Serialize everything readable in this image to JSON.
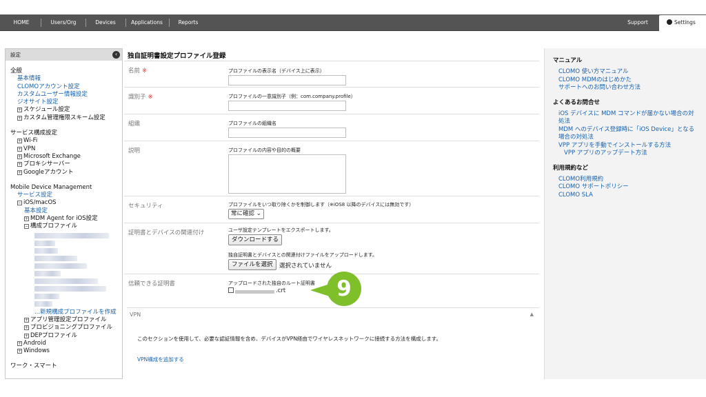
{
  "topnav": {
    "items": [
      "HOME",
      "Users/Org",
      "Devices",
      "Applications",
      "Reports"
    ],
    "support": "Support",
    "settings": "Settings"
  },
  "sidebar": {
    "header": "設定",
    "collapse_glyph": "‹",
    "section_general": "全般",
    "general_links": [
      "基本情報",
      "CLOMOアカウント設定",
      "カスタムユーザー情報設定",
      "ジオサイト設定"
    ],
    "general_expand": [
      "スケジュール設定",
      "カスタム管理権限スキーム設定"
    ],
    "section_service": "サービス構成設定",
    "service_items": [
      "Wi-Fi",
      "VPN",
      "Microsoft Exchange",
      "プロキシサーバー",
      "Googleアカウント"
    ],
    "section_mdm": "Mobile Device Management",
    "mdm_service": "サービス設定",
    "ios_macos": "iOS/macOS",
    "basic_settings": "基本設定",
    "mdm_agent": "MDM Agent for iOS設定",
    "config_profile": "構成プロファイル",
    "new_profile": "...新規構成プロファイルを作成",
    "app_mgmt": "アプリ管理設定プロファイル",
    "provisioning": "プロビジョニングプロファイル",
    "dep": "DEPプロファイル",
    "android": "Android",
    "windows": "Windows",
    "section_work": "ワーク・スマート"
  },
  "main": {
    "title": "独自証明書設定プロファイル登録",
    "required_mark": "※",
    "name_label": "名前",
    "name_desc": "プロファイルの表示名（デバイス上に表示）",
    "identifier_label": "識別子",
    "identifier_desc": "プロファイルの一意識別子（例：com.company.profile）",
    "org_label": "組織",
    "org_desc": "プロファイルの組織名",
    "description_label": "説明",
    "description_desc": "プロファイルの内容や目的の概要",
    "security_label": "セキュリティ",
    "security_desc": "プロファイルをいつ取り除くかを制御します（※iOS8 以降のデバイスには無効です）",
    "security_value": "常に確認",
    "cert_device_label": "証明書とデバイスの関連付け",
    "export_desc": "ユーザ設定テンプレートをエクスポートします。",
    "download_button": "ダウンロードする",
    "upload_desc": "独自証明書とデバイスとの関連付けファイルをアップロードします。",
    "choose_file_button": "ファイルを選択",
    "no_file_text": "選択されていません",
    "trusted_cert_label": "信頼できる証明書",
    "trusted_cert_desc": "アップロードされた独自のルート証明書",
    "cert_file_suffix": ".crt",
    "badge": "9"
  },
  "vpn": {
    "label": "VPN",
    "toggle": "▲",
    "description": "このセクションを使用して、必要な認証情報を含め、デバイスがVPN経由でワイヤレスネットワークに接続する方法を構成します。",
    "add_link": "VPN構成を追加する"
  },
  "rightpanel": {
    "manual_heading": "マニュアル",
    "manual_links": [
      "CLOMO 使い方マニュアル",
      "CLOMO MDMのはじめかた",
      "サポートへのお問い合わせ方法"
    ],
    "faq_heading": "よくあるお問合せ",
    "faq_links": [
      "iOS デバイスに MDM コマンドが届かない場合の対処法",
      "MDM へのデバイス登録時に「iOS Device」となる場合の対処法",
      "VPP アプリを手動でインストールする方法"
    ],
    "faq_sub_link": "VPP アプリのアップデート方法",
    "terms_heading": "利用規約など",
    "terms_links": [
      "CLOMO利用規約",
      "CLOMO サポートポリシー",
      "CLOMO SLA"
    ]
  }
}
